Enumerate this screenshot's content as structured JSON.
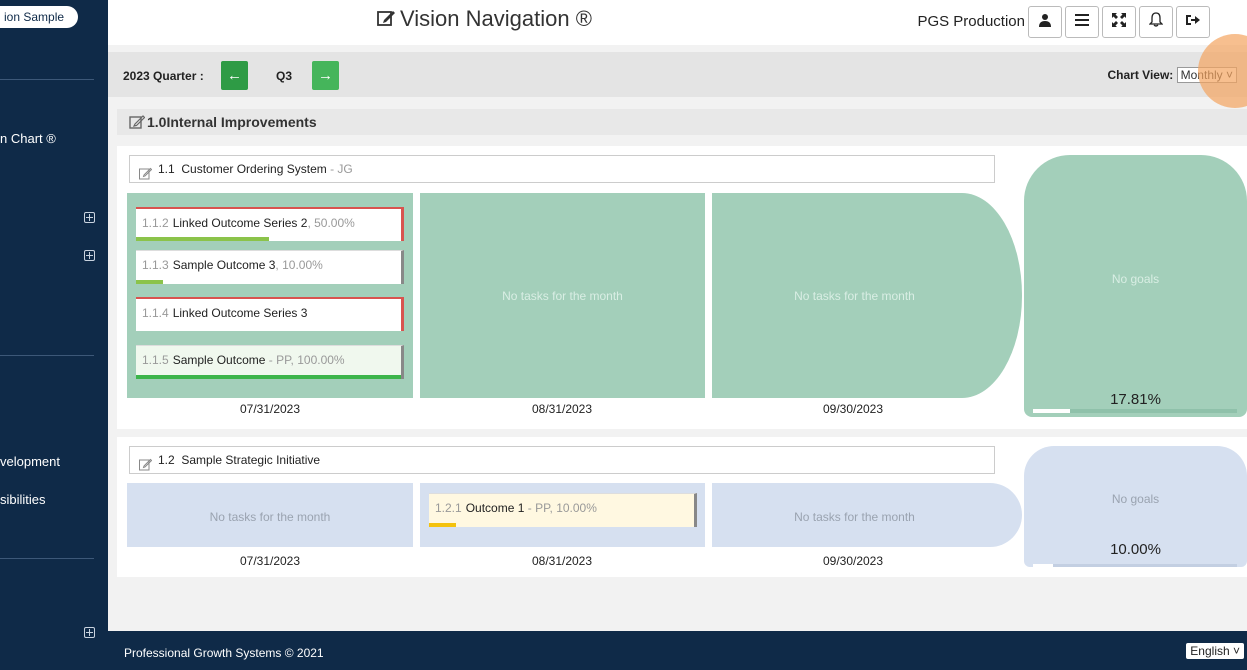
{
  "sidebar": {
    "brand": "ion Sample",
    "items": [
      {
        "label": "n Chart ®"
      },
      {
        "label": "velopment"
      },
      {
        "label": "sibilities"
      }
    ]
  },
  "header": {
    "title": "Vision Navigation ®",
    "org": "PGS Production",
    "buttons": [
      "user-icon",
      "menu-icon",
      "expand-icon",
      "bell-icon",
      "logout-icon"
    ]
  },
  "quarter": {
    "label": "2023 Quarter :",
    "prev": "←",
    "value": "Q3",
    "next": "→",
    "chart_view_label": "Chart View:",
    "chart_view_value": "Monthly ˅"
  },
  "section": {
    "title": "1.0Internal Improvements"
  },
  "initiatives": [
    {
      "number": "1.1",
      "title": "Customer Ordering System",
      "owner": " - JG",
      "months": [
        {
          "date": "07/31/2023",
          "cards": [
            {
              "num": "1.1.2",
              "label": "Linked Outcome Series 2",
              "meta": ", 50.00%",
              "progress": 0.5,
              "color": "#8bc34a",
              "linked": true
            },
            {
              "num": "1.1.3",
              "label": "Sample Outcome 3",
              "meta": ", 10.00%",
              "progress": 0.1,
              "color": "#8bc34a",
              "linked": false
            },
            {
              "num": "1.1.4",
              "label": "Linked Outcome Series 3",
              "meta": "",
              "progress": 0,
              "color": "#8bc34a",
              "linked": true
            },
            {
              "num": "1.1.5",
              "label": "Sample Outcome",
              "meta": " - PP, 100.00%",
              "progress": 1.0,
              "color": "#3cb54a",
              "linked": false
            }
          ]
        },
        {
          "date": "08/31/2023",
          "empty": "No tasks for the month"
        },
        {
          "date": "09/30/2023",
          "empty": "No tasks for the month"
        }
      ],
      "goal": {
        "label": "No goals",
        "percent": "17.81%"
      }
    },
    {
      "number": "1.2",
      "title": "Sample Strategic Initiative",
      "owner": "",
      "months": [
        {
          "date": "07/31/2023",
          "empty": "No tasks for the month"
        },
        {
          "date": "08/31/2023",
          "cards": [
            {
              "num": "1.2.1",
              "label": "Outcome 1",
              "meta": " - PP, 10.00%",
              "progress": 0.1,
              "color": "#f4c20d",
              "linked": false
            }
          ]
        },
        {
          "date": "09/30/2023",
          "empty": "No tasks for the month"
        }
      ],
      "goal": {
        "label": "No goals",
        "percent": "10.00%"
      }
    }
  ],
  "colors": {
    "sidebar": "#0f2a48",
    "green_panel": "#a3cfba",
    "blue_panel": "#d6e0f0",
    "card_yellow": "#fff8e1"
  },
  "footer": {
    "copyright": "Professional Growth Systems © 2021",
    "language": "English ˅"
  }
}
